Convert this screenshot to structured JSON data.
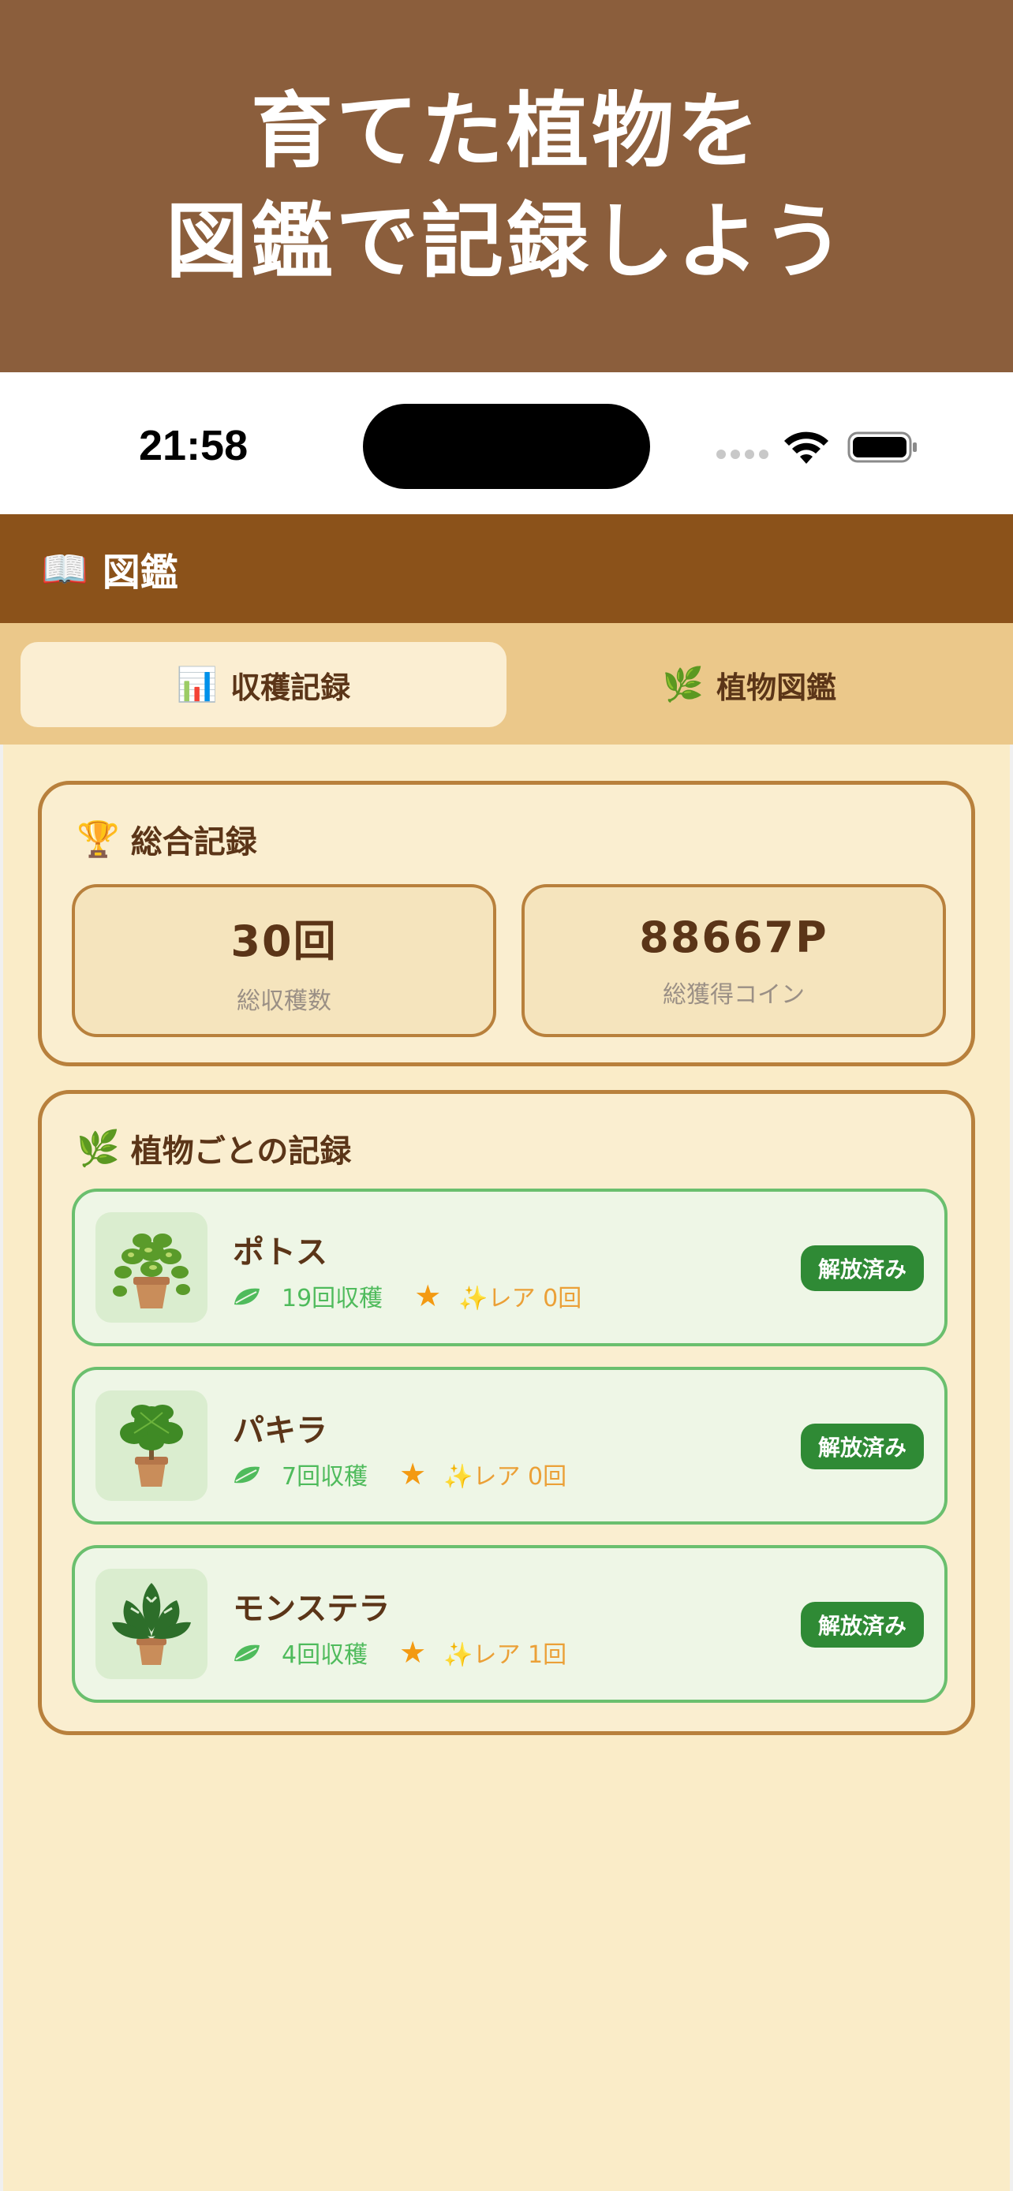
{
  "banner": {
    "line1": "育てた植物を",
    "line2": "図鑑で記録しよう"
  },
  "status_bar": {
    "time": "21:58"
  },
  "header": {
    "icon": "📖",
    "title": "図鑑"
  },
  "tabs": [
    {
      "icon": "📊",
      "label": "収穫記録",
      "active": true
    },
    {
      "icon": "🌿",
      "label": "植物図鑑",
      "active": false
    }
  ],
  "summary": {
    "icon": "🏆",
    "title": "総合記録",
    "stats": [
      {
        "value": "30回",
        "label": "総収穫数"
      },
      {
        "value": "88667P",
        "label": "総獲得コイン"
      }
    ]
  },
  "plants_section": {
    "icon": "🌿",
    "title": "植物ごとの記録",
    "items": [
      {
        "name": "ポトス",
        "harvest": "19回収穫",
        "rare": "✨レア 0回",
        "badge": "解放済み",
        "icon": "pothos-plant-icon"
      },
      {
        "name": "パキラ",
        "harvest": "7回収穫",
        "rare": "✨レア 0回",
        "badge": "解放済み",
        "icon": "pachira-plant-icon"
      },
      {
        "name": "モンステラ",
        "harvest": "4回収穫",
        "rare": "✨レア 1回",
        "badge": "解放済み",
        "icon": "monstera-plant-icon"
      }
    ]
  },
  "colors": {
    "banner_bg": "#8b5e3c",
    "header_bg": "#8b521a",
    "tab_bar_bg": "#ebc88a",
    "card_border": "#b8803c",
    "plant_border": "#6abf6e",
    "badge_bg": "#2f8a35"
  }
}
